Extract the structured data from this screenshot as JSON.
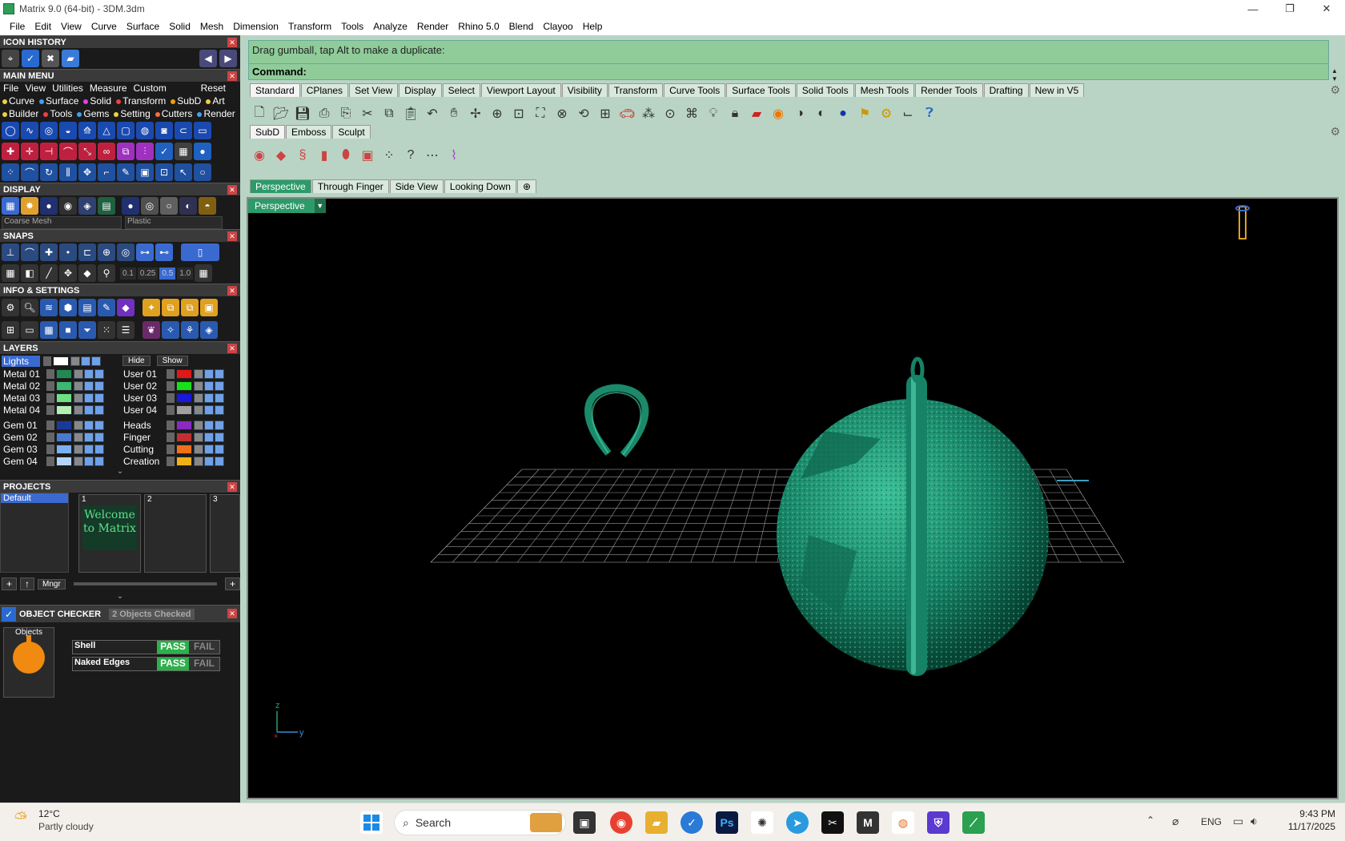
{
  "window": {
    "title": "Matrix 9.0 (64-bit) - 3DM.3dm",
    "minimize": "—",
    "maximize": "❐",
    "close": "✕"
  },
  "menubar": [
    "File",
    "Edit",
    "View",
    "Curve",
    "Surface",
    "Solid",
    "Mesh",
    "Dimension",
    "Transform",
    "Tools",
    "Analyze",
    "Render",
    "Rhino 5.0",
    "Blend",
    "Clayoo",
    "Help"
  ],
  "panels": {
    "icon_history": "ICON HISTORY",
    "main_menu": "MAIN MENU",
    "display": "DISPLAY",
    "snaps": "SNAPS",
    "info_settings": "INFO & SETTINGS",
    "layers": "LAYERS",
    "projects": "PROJECTS",
    "object_checker": "OBJECT CHECKER"
  },
  "main_menu": {
    "row1": [
      "File",
      "View",
      "Utilities",
      "Measure",
      "Custom"
    ],
    "reset": "Reset",
    "row2": [
      {
        "label": "Curve",
        "color": "#f0d040"
      },
      {
        "label": "Surface",
        "color": "#40a0f0"
      },
      {
        "label": "Solid",
        "color": "#e040e0"
      },
      {
        "label": "Transform",
        "color": "#f04040"
      },
      {
        "label": "SubD",
        "color": "#f0a000"
      },
      {
        "label": "Art",
        "color": "#f0d040"
      }
    ],
    "row3": [
      {
        "label": "Builder",
        "color": "#f0d040"
      },
      {
        "label": "Tools",
        "color": "#f04040"
      },
      {
        "label": "Gems",
        "color": "#40a0f0"
      },
      {
        "label": "Setting",
        "color": "#f0d040"
      },
      {
        "label": "Cutters",
        "color": "#f07040"
      },
      {
        "label": "Render",
        "color": "#40a0f0"
      }
    ]
  },
  "display": {
    "mesh": "Coarse Mesh",
    "material": "Plastic"
  },
  "snaps": {
    "values": [
      "0.1",
      "0.25",
      "0.5",
      "1.0"
    ]
  },
  "layers": {
    "lights": "Lights",
    "hide": "Hide",
    "show": "Show",
    "left": [
      {
        "name": "Metal 01",
        "color": "#1f8a52"
      },
      {
        "name": "Metal 02",
        "color": "#3cb870"
      },
      {
        "name": "Metal 03",
        "color": "#6fe07f"
      },
      {
        "name": "Metal 04",
        "color": "#b4f0b4"
      },
      {
        "name": "Gem 01",
        "color": "#1a3a9a"
      },
      {
        "name": "Gem 02",
        "color": "#4a7ad0"
      },
      {
        "name": "Gem 03",
        "color": "#7ab0f0"
      },
      {
        "name": "Gem 04",
        "color": "#b4d4ff"
      }
    ],
    "right": [
      {
        "name": "User 01",
        "color": "#e01818"
      },
      {
        "name": "User 02",
        "color": "#18e018"
      },
      {
        "name": "User 03",
        "color": "#1818e0"
      },
      {
        "name": "User 04",
        "color": "#a0a0a0"
      },
      {
        "name": "Heads",
        "color": "#8a2ac0"
      },
      {
        "name": "Finger",
        "color": "#c03030"
      },
      {
        "name": "Cutting",
        "color": "#f07018"
      },
      {
        "name": "Creation",
        "color": "#f0b018"
      }
    ]
  },
  "projects": {
    "default": "Default",
    "slots": [
      "1",
      "2",
      "3"
    ],
    "welcome": "Welcome to Matrix",
    "mngr": "Mngr"
  },
  "checker": {
    "count": "2  Objects Checked",
    "objects": "Objects",
    "rows": [
      {
        "name": "Shell",
        "pass": "PASS",
        "fail": "FAIL"
      },
      {
        "name": "Naked Edges",
        "pass": "PASS",
        "fail": "FAIL"
      }
    ]
  },
  "command": {
    "prompt": "Drag gumball, tap Alt to make a duplicate:",
    "label": "Command:"
  },
  "toolbar_tabs": [
    "Standard",
    "CPlanes",
    "Set View",
    "Display",
    "Select",
    "Viewport Layout",
    "Visibility",
    "Transform",
    "Curve Tools",
    "Surface Tools",
    "Solid Tools",
    "Mesh Tools",
    "Render Tools",
    "Drafting",
    "New in V5"
  ],
  "sub_tabs": [
    "SubD",
    "Emboss",
    "Sculpt"
  ],
  "view_tabs": [
    "Perspective",
    "Through Finger",
    "Side View",
    "Looking Down"
  ],
  "viewport": {
    "label": "Perspective",
    "axis_z": "z",
    "axis_y": "y"
  },
  "taskbar": {
    "weather_temp": "12°C",
    "weather_desc": "Partly cloudy",
    "search": "Search",
    "lang": "ENG",
    "time": "9:43 PM",
    "date": "11/17/2025"
  }
}
